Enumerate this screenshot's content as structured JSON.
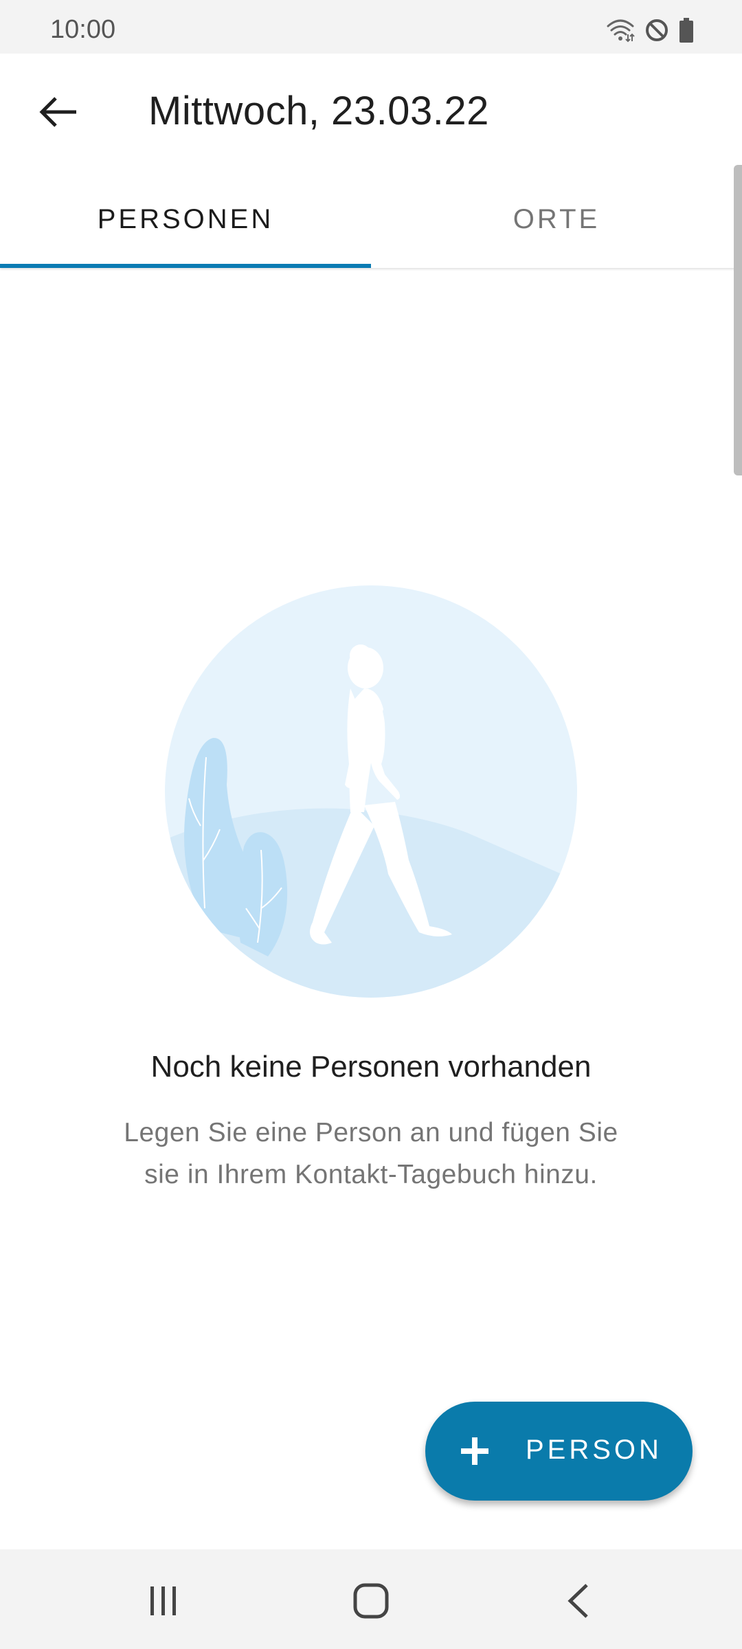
{
  "status_bar": {
    "time": "10:00",
    "icons": [
      "wifi-icon",
      "do-not-disturb-icon",
      "battery-icon"
    ]
  },
  "toolbar": {
    "back_icon": "arrow-back-icon",
    "title": "Mittwoch, 23.03.22"
  },
  "tabs": [
    {
      "label": "PERSONEN",
      "active": true
    },
    {
      "label": "ORTE",
      "active": false
    }
  ],
  "empty_state": {
    "illustration": "walking-person-illustration",
    "title": "Noch keine Personen vorhanden",
    "description": "Legen Sie eine Person an und fügen Sie sie in Ihrem Kontakt-Tagebuch hinzu."
  },
  "fab": {
    "icon": "plus-icon",
    "label": "PERSON"
  },
  "nav_bar": {
    "buttons": [
      "recent-apps-icon",
      "home-icon",
      "back-nav-icon"
    ]
  },
  "colors": {
    "accent": "#0a7bab",
    "tab_indicator": "#0a7bb3",
    "illustration_light": "#e6f3fc",
    "illustration_mid": "#d5eaf8",
    "illustration_plant": "#bcdff6"
  }
}
